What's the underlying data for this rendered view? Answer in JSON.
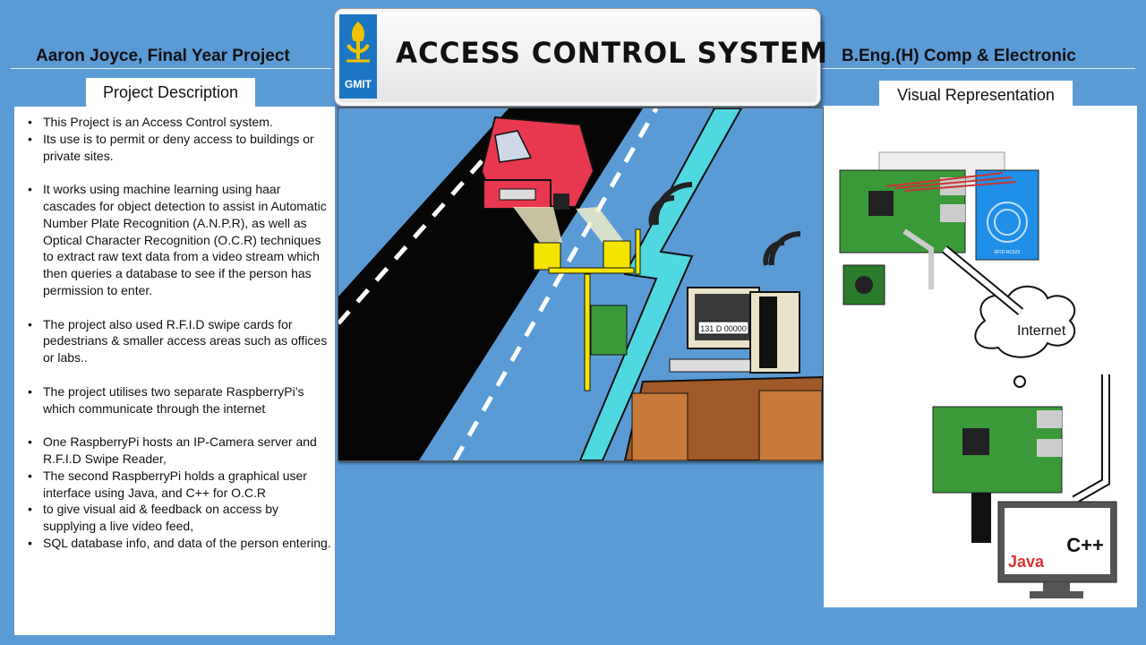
{
  "header": {
    "left": "Aaron Joyce, Final Year Project",
    "right": "B.Eng.(H) Comp & Electronic",
    "title": "ACCESS CONTROL SYSTEM",
    "logo_text": "GMIT"
  },
  "tabs": {
    "description": "Project Description",
    "visual": "Visual Representation"
  },
  "description": {
    "bullets": [
      "This Project is an Access Control system.",
      "Its use is to permit or deny access to buildings or private sites.",
      "It works using machine learning using haar cascades for object detection to assist in Automatic Number Plate Recognition (A.N.P.R), as well as Optical Character Recognition (O.C.R) techniques to extract raw text data from a video stream which then queries a database to see if the person has permission to enter.",
      "The project also used R.F.I.D swipe cards for pedestrians & smaller access areas such as offices or labs..",
      "The project utilises two separate RaspberryPi’s which communicate through the internet",
      "One RaspberryPi hosts an IP-Camera server and R.F.I.D Swipe Reader,",
      "The second RaspberryPi holds a graphical user interface using Java, and C++ for O.C.R",
      "to give visual aid & feedback on access by supplying a live video feed,",
      "SQL database info, and data of the person entering."
    ]
  },
  "scene": {
    "plate_text": "131 D 00000"
  },
  "visual": {
    "internet_label": "Internet",
    "java_label": "Java",
    "cpp_label": "C++",
    "rfid_label": "RFID-RC522"
  }
}
